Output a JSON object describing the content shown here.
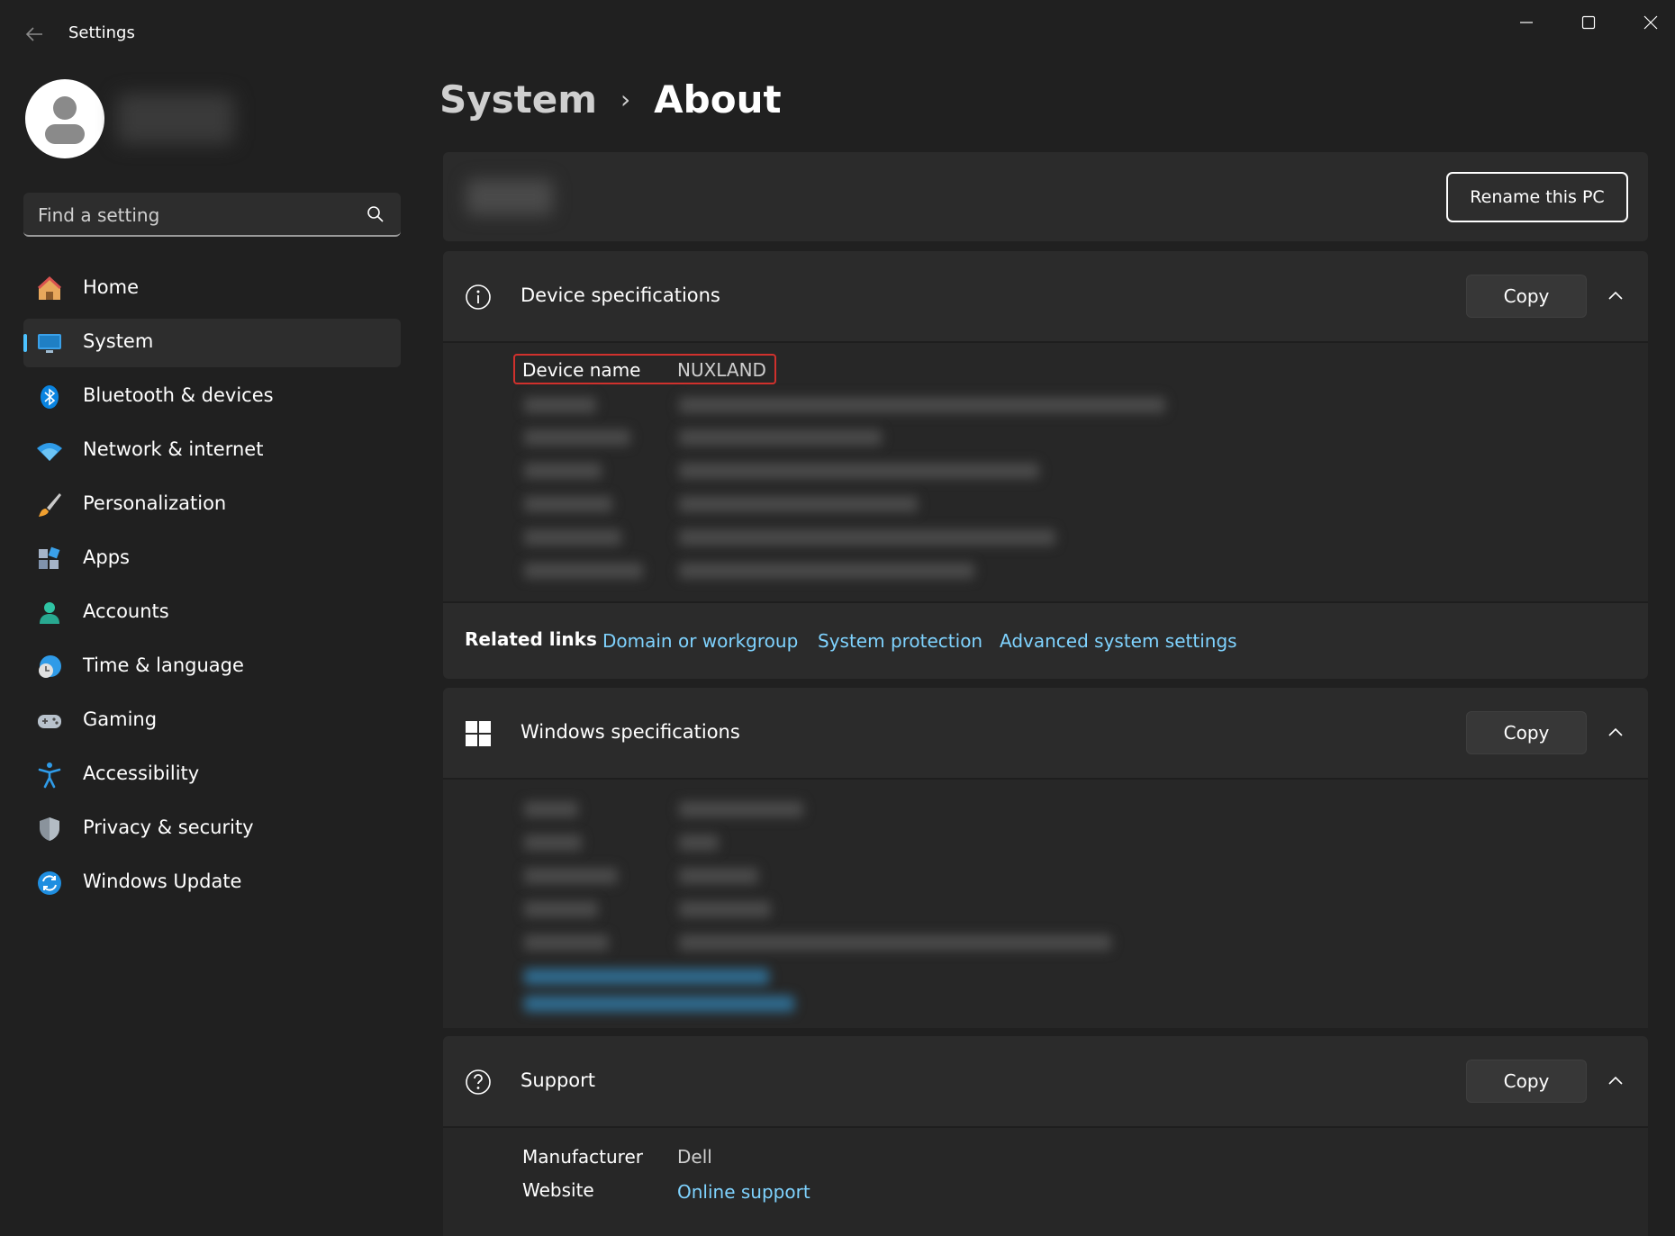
{
  "window": {
    "title": "Settings",
    "back_icon": "back-arrow-icon",
    "controls": [
      "minimize-icon",
      "maximize-icon",
      "close-icon"
    ]
  },
  "sidebar": {
    "search": {
      "placeholder": "Find a setting",
      "icon": "search-icon"
    },
    "items": [
      {
        "label": "Home",
        "icon": "home-icon",
        "active": false
      },
      {
        "label": "System",
        "icon": "system-icon",
        "active": true
      },
      {
        "label": "Bluetooth & devices",
        "icon": "bluetooth-icon",
        "active": false
      },
      {
        "label": "Network & internet",
        "icon": "wifi-icon",
        "active": false
      },
      {
        "label": "Personalization",
        "icon": "brush-icon",
        "active": false
      },
      {
        "label": "Apps",
        "icon": "apps-icon",
        "active": false
      },
      {
        "label": "Accounts",
        "icon": "accounts-icon",
        "active": false
      },
      {
        "label": "Time & language",
        "icon": "time-language-icon",
        "active": false
      },
      {
        "label": "Gaming",
        "icon": "gamepad-icon",
        "active": false
      },
      {
        "label": "Accessibility",
        "icon": "accessibility-icon",
        "active": false
      },
      {
        "label": "Privacy & security",
        "icon": "shield-icon",
        "active": false
      },
      {
        "label": "Windows Update",
        "icon": "update-icon",
        "active": false
      }
    ]
  },
  "breadcrumb": {
    "parent": "System",
    "separator": "›",
    "current": "About"
  },
  "rename": {
    "button_label": "Rename this PC"
  },
  "device_specs": {
    "title": "Device specifications",
    "icon": "info-icon",
    "copy_label": "Copy",
    "device_name_label": "Device name",
    "device_name_value": "NUXLAND"
  },
  "related_links": {
    "label": "Related links",
    "links": [
      "Domain or workgroup",
      "System protection",
      "Advanced system settings"
    ]
  },
  "windows_specs": {
    "title": "Windows specifications",
    "icon": "windows-logo-icon",
    "copy_label": "Copy"
  },
  "support": {
    "title": "Support",
    "icon": "help-icon",
    "copy_label": "Copy",
    "manufacturer_label": "Manufacturer",
    "manufacturer_value": "Dell",
    "website_label": "Website",
    "website_value": "Online support"
  },
  "colors": {
    "background": "#202020",
    "card": "#2b2b2b",
    "accent": "#4cc2ff",
    "link": "#7fd3ff",
    "highlight": "#d0312d"
  }
}
